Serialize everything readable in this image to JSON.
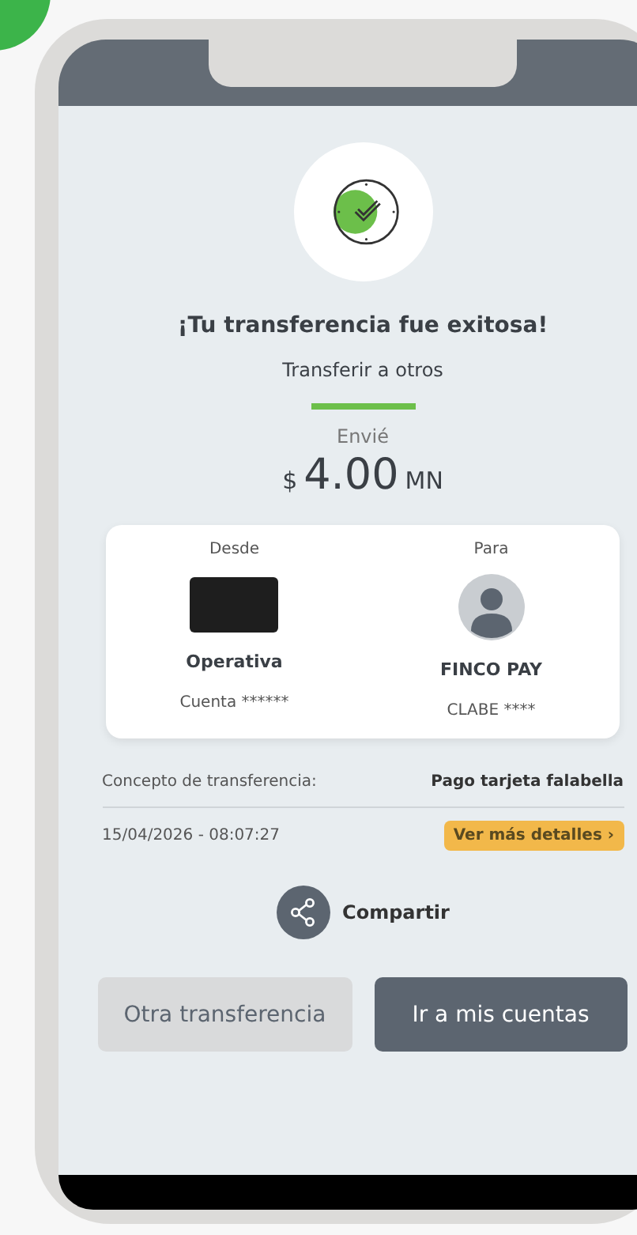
{
  "status": {
    "title": "¡Tu transferencia fue exitosa!",
    "subtitle": "Transferir a otros"
  },
  "amount": {
    "label": "Envié",
    "currency": "$",
    "value": "4.00",
    "unit": "MN"
  },
  "parties": [
    {
      "kind": "card",
      "heading": "Desde",
      "name": "Operativa",
      "account": "Cuenta ******"
    },
    {
      "kind": "contact",
      "heading": "Para",
      "name": "FINCO PAY",
      "account": "CLABE ****"
    }
  ],
  "concept": {
    "label": "Concepto de transferencia:",
    "value": "Pago tarjeta falabella"
  },
  "date": "15/04/2026 - 08:07:27",
  "details_button": {
    "label": "Ver más detalles",
    "icon": "›"
  },
  "share": {
    "label": "Compartir"
  },
  "buttons": [
    {
      "label": "Otra transferencia",
      "kind": "secondary"
    },
    {
      "label": "Ir a mis cuentas",
      "kind": "primary"
    }
  ]
}
